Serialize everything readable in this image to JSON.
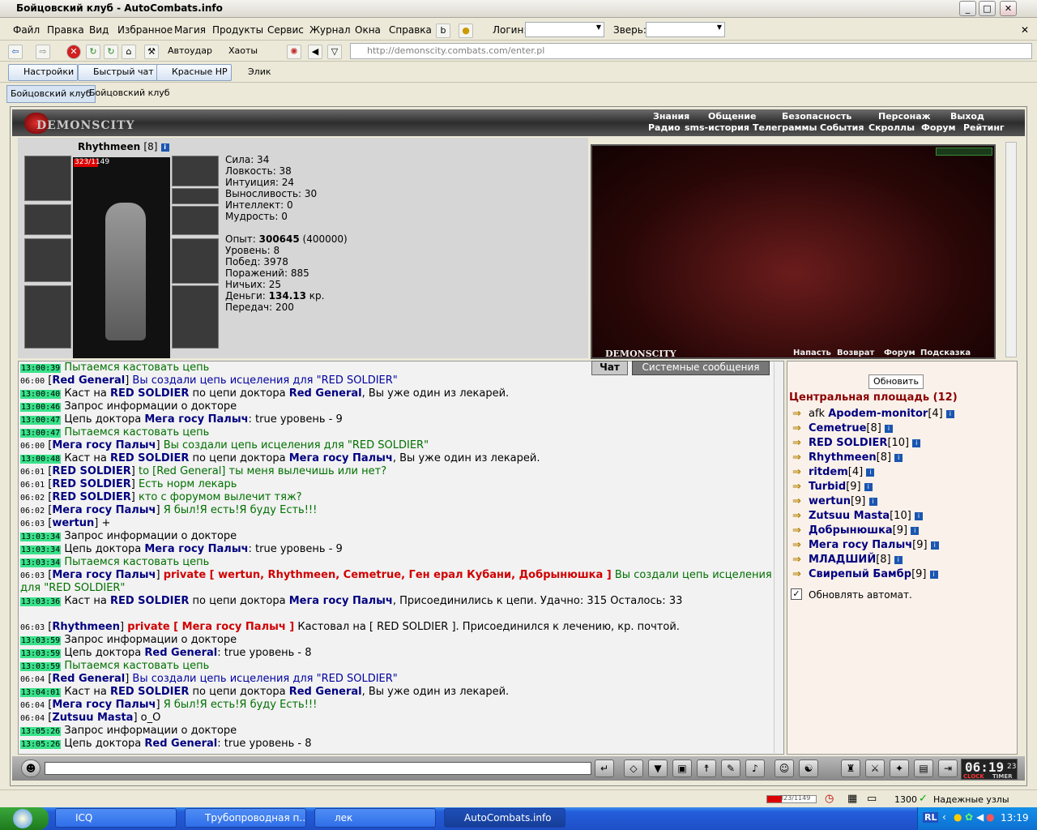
{
  "window": {
    "title": "Бойцовский клуб - AutoCombats.info"
  },
  "menu": [
    "Файл",
    "Правка",
    "Вид",
    "Избранное",
    "Магия",
    "Продукты",
    "Сервис",
    "Журнал",
    "Окна",
    "Справка"
  ],
  "login_label": "Логин:",
  "beast_label": "Зверь:",
  "toolbar": {
    "autoattack": "Автоудар",
    "chaos": "Хаоты",
    "url": "http://demonscity.combats.com/enter.pl"
  },
  "panels": {
    "settings": "Настройки",
    "quickchat": "Быстрый чат",
    "redhp": "Красные НР",
    "elik": "Элик"
  },
  "tabs": [
    "Бойцовский клуб",
    "Бойцовский клуб"
  ],
  "game": {
    "logo": "DEMONSCITY",
    "nav_top": [
      "Знания",
      "Общение",
      "Безопасность",
      "Персонаж",
      "Выход"
    ],
    "nav_bottom": [
      "Радио",
      "sms-история",
      "Телеграммы",
      "События",
      "Скроллы",
      "Форум",
      "Рейтинг"
    ]
  },
  "character": {
    "name": "Rhythmeen",
    "level": "[8]",
    "hp": "323/1149",
    "stats": [
      "Сила: 34",
      "Ловкость: 38",
      "Интуиция: 24",
      "Выносливость: 30",
      "Интеллект: 0",
      "Мудрость: 0"
    ],
    "exp_label": "Опыт: ",
    "exp": "300645",
    "exp_next": " (400000)",
    "info": [
      "Уровень: 8",
      "Побед: 3978",
      "Поражений: 885",
      "Ничьих: 25"
    ],
    "money_label": "Деньги: ",
    "money": "134.13",
    "money_unit": " кр.",
    "transfers": "Передач: 200"
  },
  "scene": {
    "caption": "DEMONSCITY",
    "nav": [
      "Напасть",
      "Возврат",
      "Форум",
      "Подсказка"
    ]
  },
  "chat_tabs": {
    "chat": "Чат",
    "system": "Системные сообщения"
  },
  "chat": [
    {
      "t": "13:00:39",
      "g": true,
      "p": [
        [
          "Пытаемся кастовать цепь",
          "gr"
        ]
      ]
    },
    {
      "t": "06:00",
      "p": [
        [
          "[",
          ""
        ],
        [
          "Red General",
          "nm"
        ],
        [
          "] ",
          ""
        ],
        [
          "Вы создали цепь исцеления для \"RED SOLDIER\"",
          "bl"
        ]
      ]
    },
    {
      "t": "13:00:40",
      "g": true,
      "p": [
        [
          "Каст на ",
          ""
        ],
        [
          "RED SOLDIER",
          "nm"
        ],
        [
          " по цепи доктора ",
          ""
        ],
        [
          "Red General",
          "nm"
        ],
        [
          ", Вы уже один из лекарей.",
          ""
        ]
      ]
    },
    {
      "t": "13:00:46",
      "g": true,
      "p": [
        [
          "Запрос информации о докторе",
          ""
        ]
      ]
    },
    {
      "t": "13:00:47",
      "g": true,
      "p": [
        [
          "Цепь доктора ",
          ""
        ],
        [
          "Мега госу Палыч",
          "nm"
        ],
        [
          ": true уровень - 9",
          ""
        ]
      ]
    },
    {
      "t": "13:00:47",
      "g": true,
      "p": [
        [
          "Пытаемся кастовать цепь",
          "gr"
        ]
      ]
    },
    {
      "t": "06:00",
      "p": [
        [
          "[",
          ""
        ],
        [
          "Мега госу Палыч",
          "nm"
        ],
        [
          "] ",
          ""
        ],
        [
          "Вы создали цепь исцеления для \"RED SOLDIER\"",
          "gr"
        ]
      ]
    },
    {
      "t": "13:00:48",
      "g": true,
      "p": [
        [
          "Каст на ",
          ""
        ],
        [
          "RED SOLDIER",
          "nm"
        ],
        [
          " по цепи доктора ",
          ""
        ],
        [
          "Мега госу Палыч",
          "nm"
        ],
        [
          ", Вы уже один из лекарей.",
          ""
        ]
      ]
    },
    {
      "t": "06:01",
      "p": [
        [
          "[",
          ""
        ],
        [
          "RED SOLDIER",
          "nm"
        ],
        [
          "] ",
          ""
        ],
        [
          "to [Red General] ты меня вылечишь или нет?",
          "gr"
        ]
      ]
    },
    {
      "t": "06:01",
      "p": [
        [
          "[",
          ""
        ],
        [
          "RED SOLDIER",
          "nm"
        ],
        [
          "] ",
          ""
        ],
        [
          "Есть норм лекарь",
          "gr"
        ]
      ]
    },
    {
      "t": "06:02",
      "p": [
        [
          "[",
          ""
        ],
        [
          "RED SOLDIER",
          "nm"
        ],
        [
          "] ",
          ""
        ],
        [
          "кто с форумом вылечит тяж?",
          "gr"
        ]
      ]
    },
    {
      "t": "06:02",
      "p": [
        [
          "[",
          ""
        ],
        [
          "Мега госу Палыч",
          "nm"
        ],
        [
          "] ",
          ""
        ],
        [
          "Я был!Я есть!Я буду Есть!!!",
          "gr"
        ]
      ]
    },
    {
      "t": "06:03",
      "p": [
        [
          "[",
          ""
        ],
        [
          "wertun",
          "nm"
        ],
        [
          "] +",
          ""
        ]
      ]
    },
    {
      "t": "13:03:34",
      "g": true,
      "p": [
        [
          "Запрос информации о докторе",
          ""
        ]
      ]
    },
    {
      "t": "13:03:34",
      "g": true,
      "p": [
        [
          "Цепь доктора ",
          ""
        ],
        [
          "Мега госу Палыч",
          "nm"
        ],
        [
          ": true уровень - 9",
          ""
        ]
      ]
    },
    {
      "t": "13:03:34",
      "g": true,
      "p": [
        [
          "Пытаемся кастовать цепь",
          "gr"
        ]
      ]
    },
    {
      "t": "06:03",
      "p": [
        [
          "[",
          ""
        ],
        [
          "Мега госу Палыч",
          "nm"
        ],
        [
          "] ",
          ""
        ],
        [
          "private [ wertun, Rhythmeen, Cemetrue, Ген ерал Кубани, Добрынюшка ]",
          "rd"
        ],
        [
          " Вы создали цепь исцеления",
          "gr"
        ]
      ]
    },
    {
      "t": "",
      "p": [
        [
          "для \"RED SOLDIER\"",
          "gr"
        ]
      ]
    },
    {
      "t": "13:03:36",
      "g": true,
      "p": [
        [
          "Каст на ",
          ""
        ],
        [
          "RED SOLDIER",
          "nm"
        ],
        [
          " по цепи доктора ",
          ""
        ],
        [
          "Мега госу Палыч",
          "nm"
        ],
        [
          ", Присоединились к цепи. Удачно: 315 Осталось: 33",
          ""
        ]
      ]
    },
    {
      "t": "",
      "p": [
        [
          "",
          ""
        ]
      ]
    },
    {
      "t": "06:03",
      "p": [
        [
          "[",
          ""
        ],
        [
          "Rhythmeen",
          "nm"
        ],
        [
          "] ",
          ""
        ],
        [
          "private [ Мега госу Палыч ]",
          "rd"
        ],
        [
          " Кастовал на [ RED SOLDIER ]. Присоединился к лечению, кр. почтой.",
          ""
        ]
      ]
    },
    {
      "t": "13:03:59",
      "g": true,
      "p": [
        [
          "Запрос информации о докторе",
          ""
        ]
      ]
    },
    {
      "t": "13:03:59",
      "g": true,
      "p": [
        [
          "Цепь доктора ",
          ""
        ],
        [
          "Red General",
          "nm"
        ],
        [
          ": true уровень - 8",
          ""
        ]
      ]
    },
    {
      "t": "13:03:59",
      "g": true,
      "p": [
        [
          "Пытаемся кастовать цепь",
          "gr"
        ]
      ]
    },
    {
      "t": "06:04",
      "p": [
        [
          "[",
          ""
        ],
        [
          "Red General",
          "nm"
        ],
        [
          "] ",
          ""
        ],
        [
          "Вы создали цепь исцеления для \"RED SOLDIER\"",
          "bl"
        ]
      ]
    },
    {
      "t": "13:04:01",
      "g": true,
      "p": [
        [
          "Каст на ",
          ""
        ],
        [
          "RED SOLDIER",
          "nm"
        ],
        [
          " по цепи доктора ",
          ""
        ],
        [
          "Red General",
          "nm"
        ],
        [
          ", Вы уже один из лекарей.",
          ""
        ]
      ]
    },
    {
      "t": "06:04",
      "p": [
        [
          "[",
          ""
        ],
        [
          "Мега госу Палыч",
          "nm"
        ],
        [
          "] ",
          ""
        ],
        [
          "Я был!Я есть!Я буду Есть!!!",
          "gr"
        ]
      ]
    },
    {
      "t": "06:04",
      "p": [
        [
          "[",
          ""
        ],
        [
          "Zutsuu Masta",
          "nm"
        ],
        [
          "] o_O",
          ""
        ]
      ]
    },
    {
      "t": "13:05:26",
      "g": true,
      "p": [
        [
          "Запрос информации о докторе",
          ""
        ]
      ]
    },
    {
      "t": "13:05:26",
      "g": true,
      "p": [
        [
          "Цепь доктора ",
          ""
        ],
        [
          "Red General",
          "nm"
        ],
        [
          ": true уровень - 8",
          ""
        ]
      ]
    }
  ],
  "sidebar": {
    "refresh": "Обновить",
    "location": "Центральная площадь (12)",
    "auto": "Обновлять автомат.",
    "users": [
      {
        "pre": "afk ",
        "name": "Apodem-monitor",
        "lvl": "[4]"
      },
      {
        "pre": "",
        "name": "Cemetrue",
        "lvl": "[8]"
      },
      {
        "pre": "",
        "name": "RED SOLDIER",
        "lvl": "[10]"
      },
      {
        "pre": "",
        "name": "Rhythmeen",
        "lvl": "[8]"
      },
      {
        "pre": "",
        "name": "ritdem",
        "lvl": "[4]"
      },
      {
        "pre": "",
        "name": "Turbid",
        "lvl": "[9]"
      },
      {
        "pre": "",
        "name": "wertun",
        "lvl": "[9]"
      },
      {
        "pre": "",
        "name": "Zutsuu Masta",
        "lvl": "[10]"
      },
      {
        "pre": "",
        "name": "Добрынюшка",
        "lvl": "[9]"
      },
      {
        "pre": "",
        "name": "Мега госу Палыч",
        "lvl": "[9]"
      },
      {
        "pre": "",
        "name": "МЛАДШИЙ",
        "lvl": "[8]"
      },
      {
        "pre": "",
        "name": "Свирепый Бамбр",
        "lvl": "[9]"
      }
    ]
  },
  "clock": "06:19",
  "clock_sec": "23",
  "clock_labels": [
    "CLOCK",
    "TIMER"
  ],
  "status": {
    "hp": "323/1149",
    "count": "1300",
    "zone": "Надежные узлы"
  },
  "taskbar": {
    "items": [
      "ICQ",
      "Трубопроводная п...",
      "лек",
      "AutoCombats.info"
    ],
    "lang": "RL",
    "time": "13:19"
  }
}
